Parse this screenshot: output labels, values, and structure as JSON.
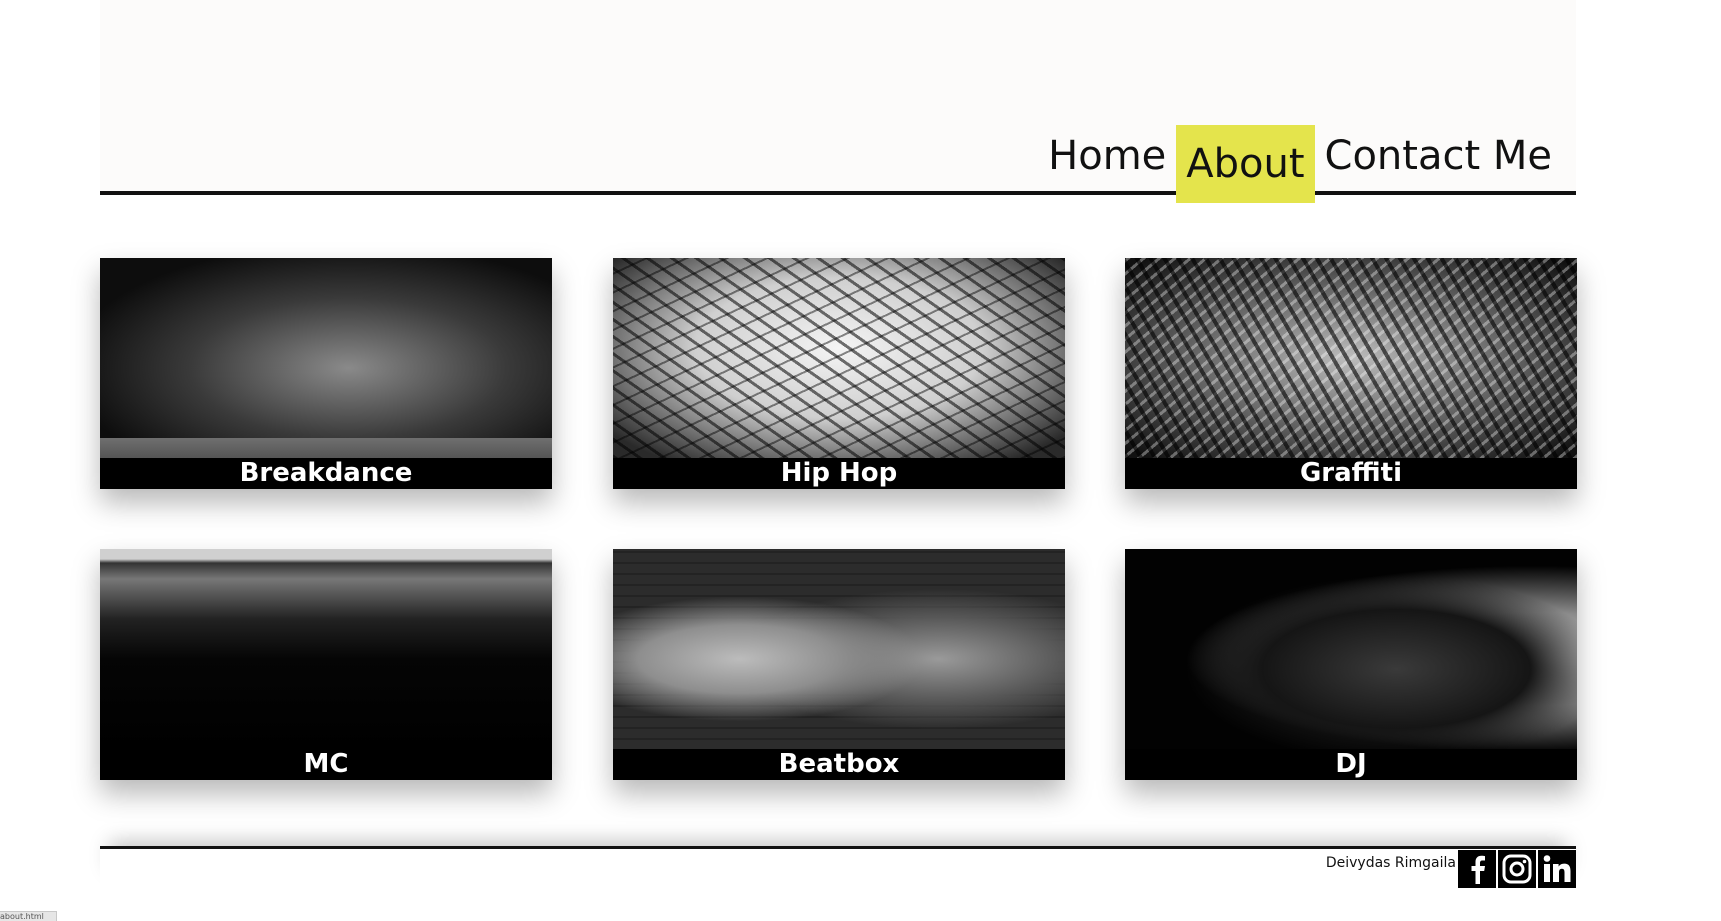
{
  "nav": {
    "items": [
      {
        "label": "Home",
        "active": false
      },
      {
        "label": "About",
        "active": true
      },
      {
        "label": "Contact Me",
        "active": false
      }
    ]
  },
  "cards": [
    {
      "caption": "Breakdance",
      "image": "breakdance-photo"
    },
    {
      "caption": "Hip Hop",
      "image": "hip-hop-photo"
    },
    {
      "caption": "Graffiti",
      "image": "graffiti-photo"
    },
    {
      "caption": "MC",
      "image": "mc-photo"
    },
    {
      "caption": "Beatbox",
      "image": "beatbox-photo"
    },
    {
      "caption": "DJ",
      "image": "dj-photo"
    }
  ],
  "footer": {
    "author": "Deivydas Rimgaila",
    "social": [
      "facebook-icon",
      "instagram-icon",
      "linkedin-icon"
    ]
  },
  "status_bar": {
    "url_fragment": "about.html"
  },
  "colors": {
    "active_nav": "#e4e44c",
    "card_bg": "#000000",
    "header_bg": "#fcfbfa"
  }
}
